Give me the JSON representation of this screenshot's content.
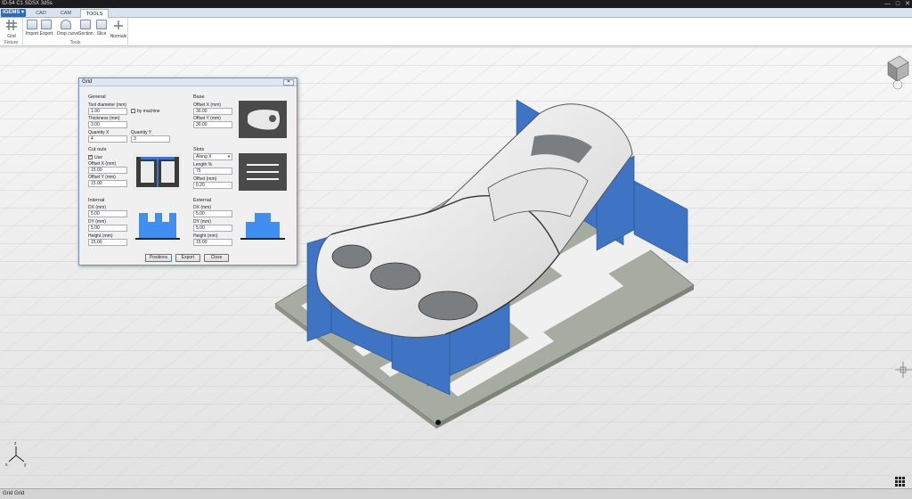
{
  "window": {
    "title": "ID-54 C1 SDSX 3d5s",
    "controls": [
      "—",
      "□",
      "✕"
    ]
  },
  "ribbon": {
    "app_menu": "IGEMS ▾",
    "tabs": [
      {
        "label": "CAD",
        "active": false
      },
      {
        "label": "CAM",
        "active": false
      },
      {
        "label": "TOOLS",
        "active": true
      }
    ],
    "groups": [
      {
        "label": "Fixture",
        "buttons": [
          {
            "label": "Grid",
            "icon": "grid-icon"
          }
        ]
      },
      {
        "label": "Tools",
        "buttons": [
          {
            "label": "Import",
            "icon": "import-icon"
          },
          {
            "label": "Export",
            "icon": "export-icon"
          },
          {
            "label": "Drop curve",
            "icon": "drop-curve-icon"
          },
          {
            "label": "Section",
            "icon": "section-icon"
          },
          {
            "label": "Slice",
            "icon": "slice-icon"
          },
          {
            "label": "Normals",
            "icon": "normals-icon"
          }
        ]
      }
    ]
  },
  "dialog": {
    "title": "Grid",
    "close": "✕",
    "general": {
      "heading": "General",
      "tool_diameter_label": "Tool diameter (mm)",
      "tool_diameter": "1.00",
      "by_machine_label": "by machine",
      "thickness_label": "Thickness (mm)",
      "thickness": "3.00",
      "quantity_x_label": "Quantity X",
      "quantity_x": "4",
      "quantity_y_label": "Quantity Y",
      "quantity_y": "3"
    },
    "base": {
      "heading": "Base",
      "offset_x_label": "Offset X (mm)",
      "offset_x": "30.00",
      "offset_y_label": "Offset Y (mm)",
      "offset_y": "30.00"
    },
    "cutouts": {
      "heading": "Cut outs",
      "use_label": "Use",
      "offset_x_label": "Offset X (mm)",
      "offset_x": "15.00",
      "offset_y_label": "Offset Y (mm)",
      "offset_y": "15.00"
    },
    "slots": {
      "heading": "Slots",
      "direction": "Along X",
      "length_label": "Length %",
      "length": "75",
      "offset_label": "Offset (mm)",
      "offset": "0.20"
    },
    "internal": {
      "heading": "Internal",
      "dx_label": "DX (mm)",
      "dx": "5.00",
      "dy_label": "DY (mm)",
      "dy": "5.00",
      "height_label": "Height (mm)",
      "height": "15.00"
    },
    "external": {
      "heading": "External",
      "dx_label": "DX (mm)",
      "dx": "5.00",
      "dy_label": "DY (mm)",
      "dy": "5.00",
      "height_label": "Height (mm)",
      "height": "15.00"
    },
    "buttons": {
      "positions": "Positions",
      "export": "Export",
      "close": "Close"
    }
  },
  "status": {
    "text": "Grid  Grid"
  },
  "colors": {
    "rib_blue": "#3f73c4",
    "base_gray": "#a7aca3",
    "part_white": "#f2f2f2",
    "ribbon_accent": "#2a6cb5"
  }
}
